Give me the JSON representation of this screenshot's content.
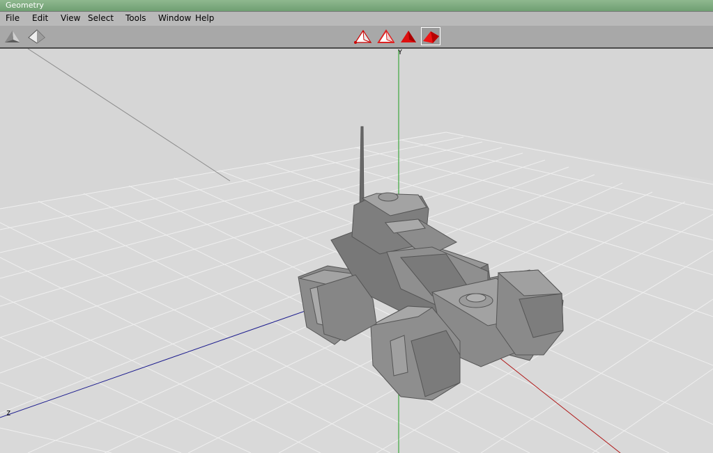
{
  "window": {
    "title": "Geometry"
  },
  "menu": [
    "File",
    "Edit",
    "View",
    "Select",
    "Tools",
    "Window",
    "Help"
  ],
  "toolbar": {
    "left_icons": [
      "shaded-pyramid-icon",
      "wireframe-pyramid-icon"
    ],
    "center_icons": [
      "vertex-select-icon",
      "edge-select-icon",
      "face-select-icon",
      "object-select-icon"
    ],
    "active": "object-select-icon"
  },
  "viewport": {
    "axis_labels": {
      "y": "Y",
      "z": "Z"
    },
    "colors": {
      "y_axis": "#1e9e1e",
      "z_axis": "#1c1c8e",
      "x_axis": "#b01818",
      "background": "#d6d6d6",
      "grid": "#f2f2f2",
      "model": "#7f7f7f"
    }
  }
}
